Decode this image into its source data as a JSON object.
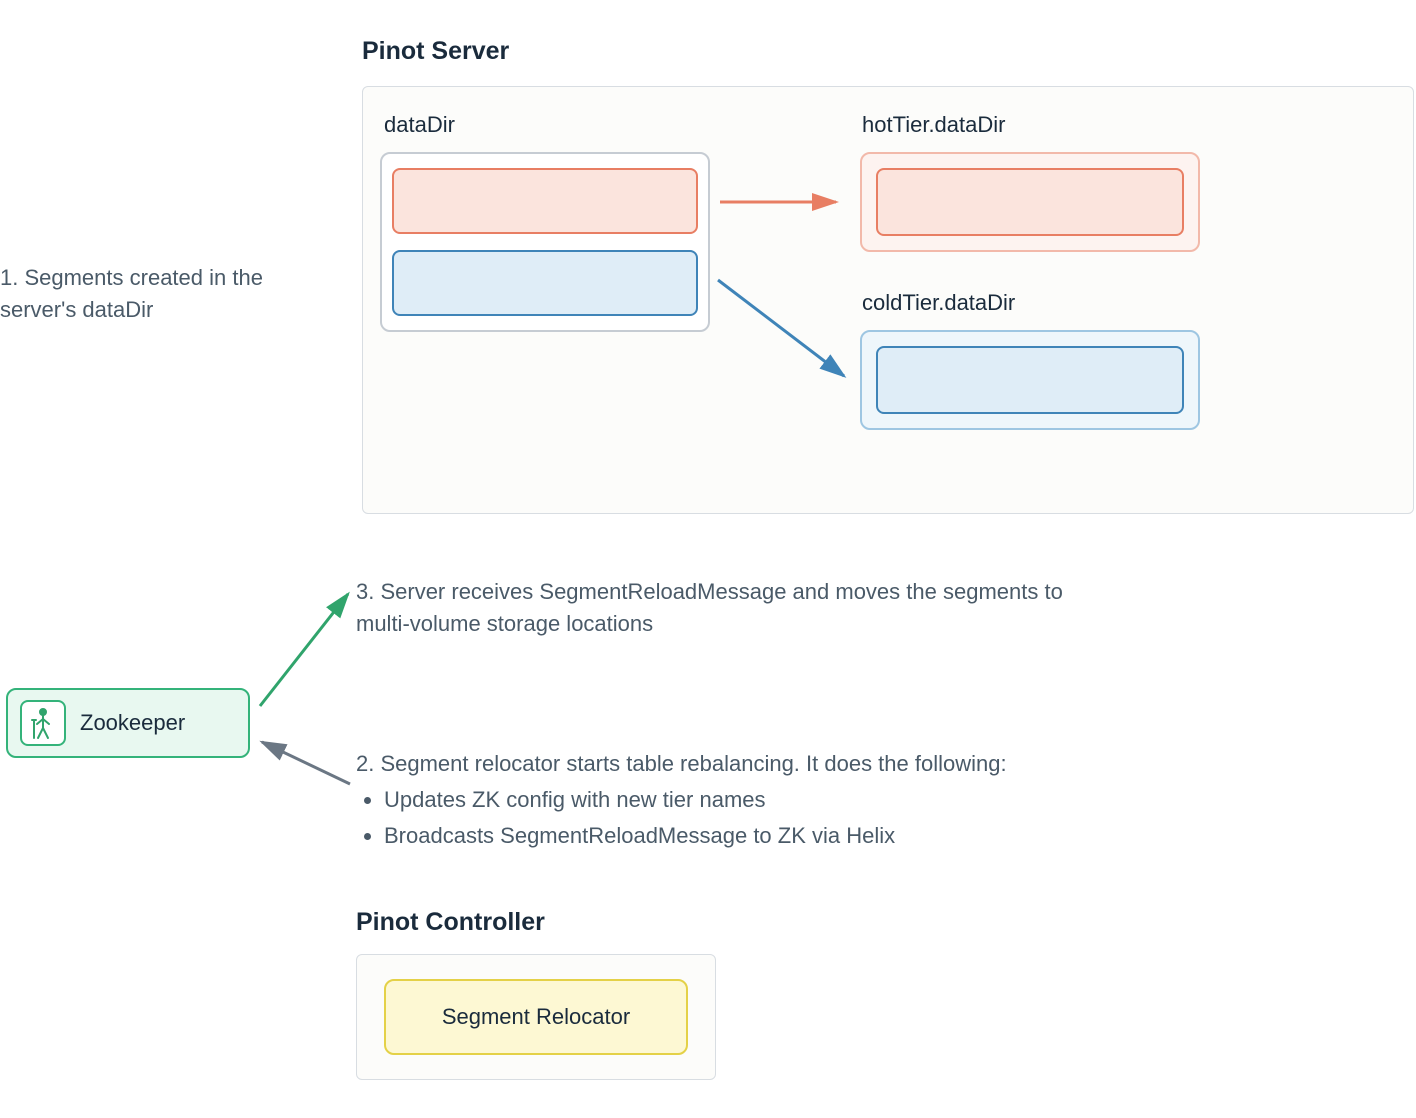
{
  "titles": {
    "pinot_server": "Pinot Server",
    "pinot_controller": "Pinot Controller"
  },
  "labels": {
    "dataDir": "dataDir",
    "hotTier": "hotTier.dataDir",
    "coldTier": "coldTier.dataDir",
    "zookeeper": "Zookeeper",
    "segment_relocator": "Segment Relocator"
  },
  "steps": {
    "one": "1. Segments created in the server's dataDir",
    "two": "2. Segment relocator starts table rebalancing. It does the following:",
    "two_bullets": [
      "Updates ZK config with new tier names",
      "Broadcasts SegmentReloadMessage to ZK via Helix"
    ],
    "three": "3. Server receives SegmentReloadMessage and moves the segments to multi-volume storage locations"
  },
  "colors": {
    "hot_border": "#e87e63",
    "hot_fill": "#fbe4dd",
    "cold_border": "#3f84b8",
    "cold_fill": "#dfedf7",
    "green": "#30a46c",
    "gray_arrow": "#6b7784",
    "yellow_border": "#e4d147"
  }
}
